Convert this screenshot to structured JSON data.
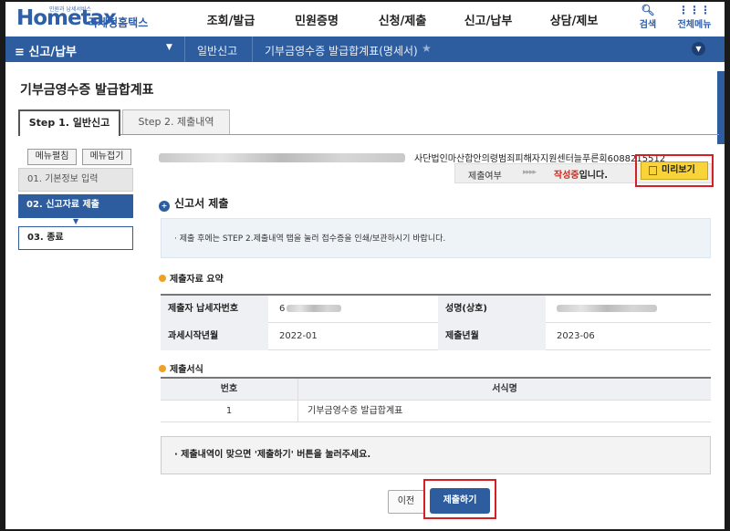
{
  "header": {
    "logo_sub": "민원과 납세서비스",
    "logo_main": "Hometax",
    "logo_kr": "국세청홈택스",
    "menu": [
      "조회/발급",
      "민원증명",
      "신청/제출",
      "신고/납부",
      "상담/제보"
    ],
    "search_label": "검색",
    "allmenu_label": "전체메뉴"
  },
  "breadcrumb": {
    "menu": "≡  신고/납부",
    "items": [
      "일반신고",
      "기부금영수증 발급합계표(명세서)"
    ]
  },
  "page": {
    "title": "기부금영수증 발급합계표",
    "tabs": [
      "Step 1. 일반신고",
      "Step 2. 제출내역"
    ]
  },
  "leftnav": {
    "expand": "메뉴펼침",
    "collapse": "메뉴접기",
    "steps": [
      "01. 기본정보 입력",
      "02. 신고자료 제출",
      "03. 종료"
    ]
  },
  "status": {
    "org_name": "사단법인마산합안의령범죄피해자지원센터늘푸른회6088215512",
    "label": "제출여부",
    "arrows": "▸▸▸▸",
    "state_hl": "작성중",
    "state_rest": "입니다.",
    "preview": "미리보기"
  },
  "section": {
    "title": "신고서 제출",
    "info": "· 제출 후에는 STEP 2.제출내역 탭을 눌러 접수증을 인쇄/보관하시기 바랍니다."
  },
  "summary": {
    "title": "제출자료 요약",
    "taxpayer_no_label": "제출자 납세자번호",
    "taxpayer_no_value": "6",
    "name_label": "성명(상호)",
    "start_label": "과세시작년월",
    "start_value": "2022-01",
    "submit_label": "제출년월",
    "submit_value": "2023-06"
  },
  "forms": {
    "title": "제출서식",
    "col_no": "번호",
    "col_name": "서식명",
    "rows": [
      {
        "no": "1",
        "name": "기부금영수증 발급합계표"
      }
    ]
  },
  "notice": "· 제출내역이 맞으면 '제출하기' 버튼을 눌러주세요.",
  "buttons": {
    "prev": "이전",
    "submit": "제출하기"
  }
}
